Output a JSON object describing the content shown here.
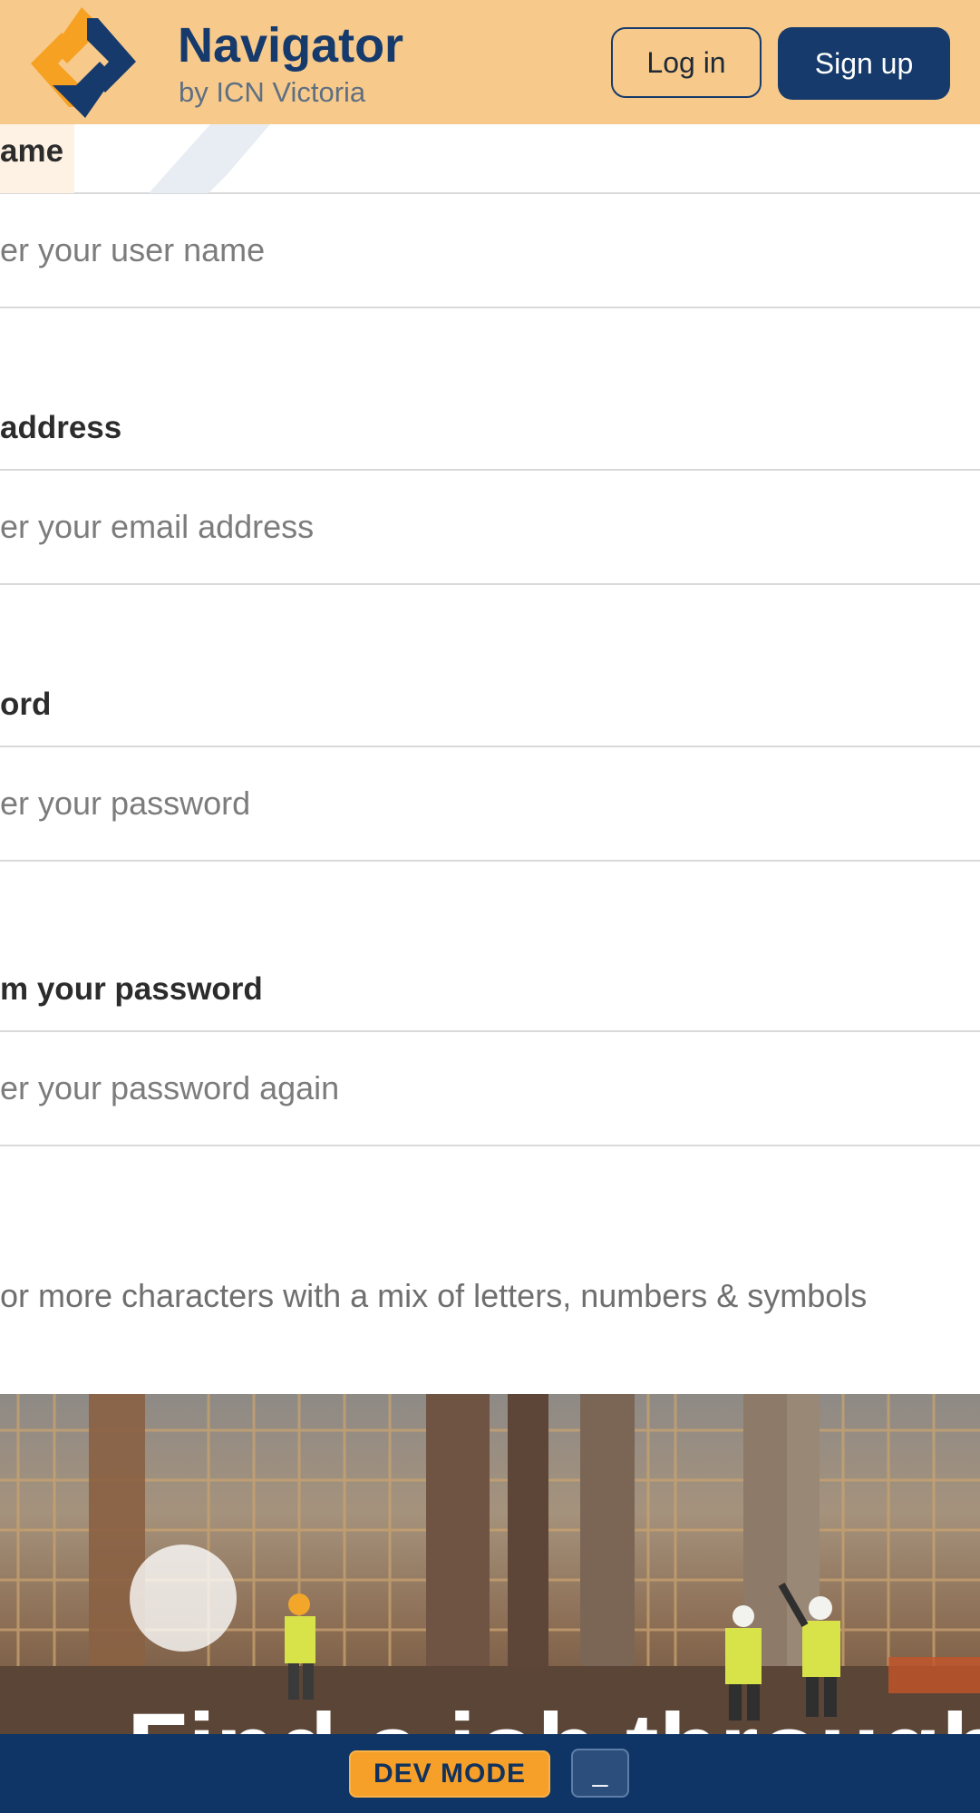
{
  "header": {
    "brand_name": "Navigator",
    "brand_sub": "by ICN Victoria",
    "login_label": "Log in",
    "signup_label": "Sign up"
  },
  "form": {
    "username": {
      "label": "ame",
      "placeholder": "er your user name"
    },
    "email": {
      "label": "address",
      "placeholder": "er your email address"
    },
    "password": {
      "label": "ord",
      "placeholder": "er your password"
    },
    "confirm": {
      "label": "m your password",
      "placeholder": "er your password again"
    },
    "hint": "or more characters with a mix of letters, numbers & symbols"
  },
  "hero": {
    "title": "Find a job through"
  },
  "devbar": {
    "badge": "DEV MODE",
    "minimize_label": "_"
  },
  "icons": {
    "logo": "navigator-logo-icon",
    "decoration": "chevron-decoration-icon",
    "hero_button": "play-circle-icon"
  },
  "colors": {
    "header_bg": "#f7ca8c",
    "brand_navy": "#163a6b",
    "dev_badge": "#f6a02a",
    "devbar_bg": "#0f3566"
  }
}
